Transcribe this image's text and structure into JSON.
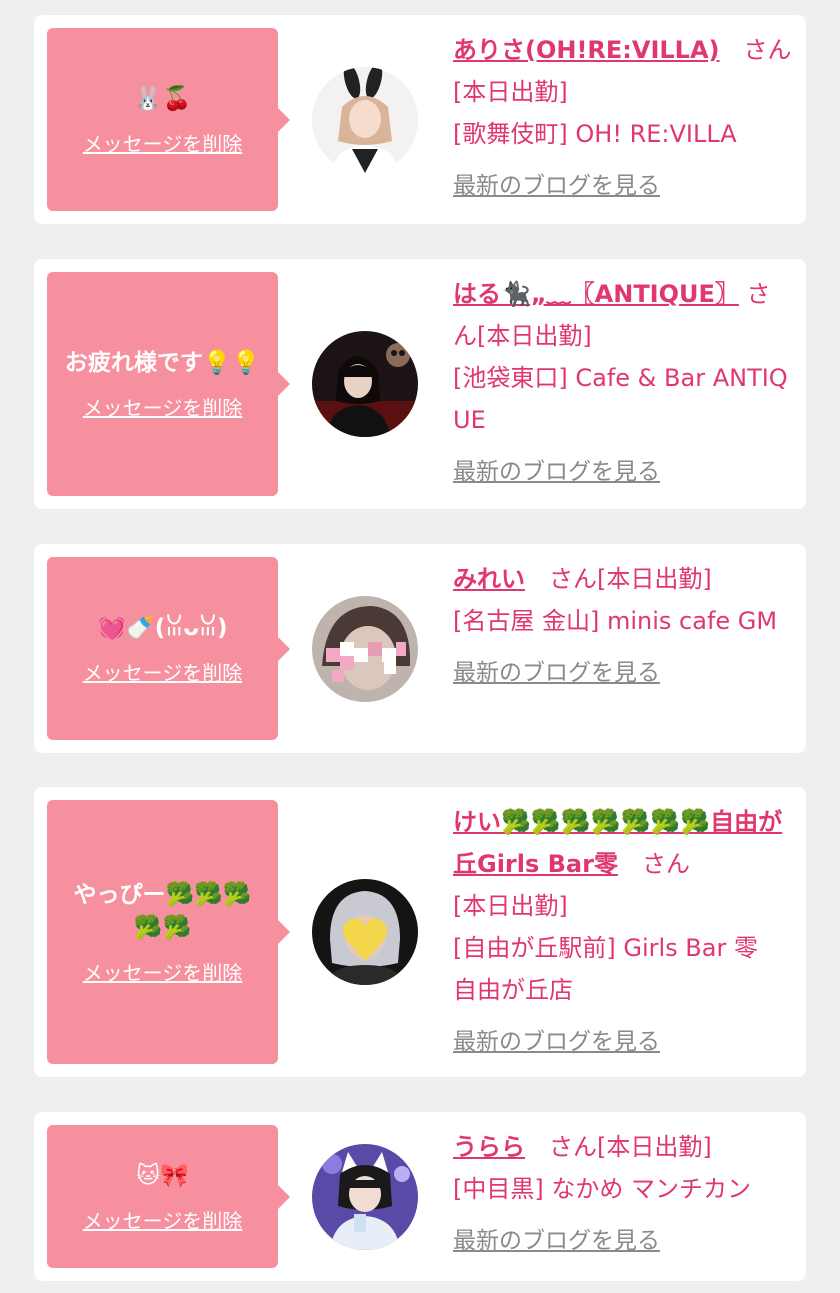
{
  "items": [
    {
      "message": "🐰🍒",
      "delete_label": "メッセージを削除",
      "name": "ありさ(OH!RE:VILLA)",
      "san_label": "　さん",
      "status": "[本日出勤]",
      "area": "[歌舞伎町]",
      "shop": "OH! RE:VILLA",
      "blog_label": "最新のブログを見る",
      "avatar_icon": "avatar-bunny-girl"
    },
    {
      "message": "お疲れ様です💡💡",
      "delete_label": "メッセージを削除",
      "name": "はる🐈‍⬛„﹏〖ANTIQUE〗",
      "san_label": "さん",
      "status": "[本日出勤]",
      "area": "[池袋東口]",
      "shop": "Cafe & Bar ANTIQUE",
      "blog_label": "最新のブログを見る",
      "avatar_icon": "avatar-dark-girl"
    },
    {
      "message": "💓🍼(ꈍᴗꈍ)",
      "delete_label": "メッセージを削除",
      "name": "みれい",
      "san_label": "　さん",
      "status": "[本日出勤]",
      "area": "[名古屋 金山]",
      "shop": "minis cafe GM",
      "blog_label": "最新のブログを見る",
      "avatar_icon": "avatar-ribbon-girl"
    },
    {
      "message": "やっぴー🥦🥦🥦🥦🥦",
      "delete_label": "メッセージを削除",
      "name": "けい🥦🥦🥦🥦🥦🥦🥦自由が丘Girls Bar零",
      "san_label": "　さん",
      "status": "[本日出勤]",
      "area": "[自由が丘駅前]",
      "shop": "Girls Bar 零　自由が丘店",
      "blog_label": "最新のブログを見る",
      "avatar_icon": "avatar-heart-face-girl"
    },
    {
      "message": "🐱🎀",
      "delete_label": "メッセージを削除",
      "name": "うらら",
      "san_label": "　さん",
      "status": "[本日出勤]",
      "area": "[中目黒]",
      "shop": "なかめ マンチカン",
      "blog_label": "最新のブログを見る",
      "avatar_icon": "avatar-cat-ear-girl"
    }
  ],
  "colors": {
    "page_bg": "#efefef",
    "card_bg": "#ffffff",
    "bubble_bg": "#f7909e",
    "accent": "#e0386c",
    "link_gray": "#8a8a8a"
  }
}
